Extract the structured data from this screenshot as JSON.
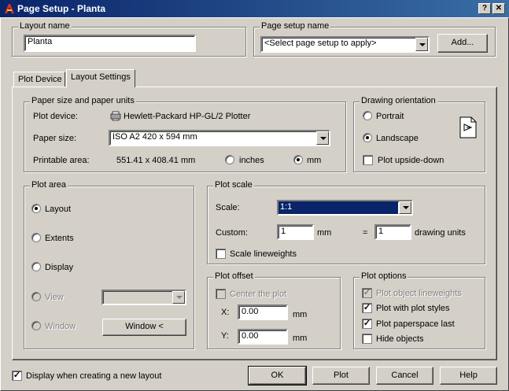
{
  "window": {
    "title": "Page Setup - Planta",
    "help_btn": "?",
    "close_btn": "✕"
  },
  "layout_name": {
    "label": "Layout name",
    "value": "Planta"
  },
  "page_setup_name": {
    "label": "Page setup name",
    "value": "<Select page setup to apply>",
    "add_button": "Add..."
  },
  "tabs": [
    {
      "label": "Plot Device"
    },
    {
      "label": "Layout Settings"
    }
  ],
  "paper": {
    "group_label": "Paper size and paper units",
    "plot_device_label": "Plot device:",
    "plot_device_value": "Hewlett-Packard HP-GL/2 Plotter",
    "paper_size_label": "Paper size:",
    "paper_size_value": "ISO A2 420 x 594 mm",
    "printable_area_label": "Printable area:",
    "printable_area_value": "551.41 x 408.41 mm",
    "inches_label": "inches",
    "mm_label": "mm",
    "selected_unit": "mm"
  },
  "orientation": {
    "group_label": "Drawing orientation",
    "portrait": "Portrait",
    "landscape": "Landscape",
    "upside_down": "Plot upside-down",
    "selected": "landscape",
    "upside_down_checked": false
  },
  "plot_area": {
    "group_label": "Plot area",
    "layout": "Layout",
    "extents": "Extents",
    "display": "Display",
    "view": "View",
    "window": "Window",
    "window_button": "Window <",
    "selected": "layout"
  },
  "plot_scale": {
    "group_label": "Plot scale",
    "scale_label": "Scale:",
    "scale_value": "1:1",
    "custom_label": "Custom:",
    "custom_mm_value": "1",
    "mm_unit": "mm",
    "equals": "=",
    "custom_units_value": "1",
    "drawing_units": "drawing units",
    "scale_lineweights": "Scale lineweights",
    "scale_lineweights_checked": false
  },
  "plot_offset": {
    "group_label": "Plot offset",
    "center": "Center the plot",
    "x_label": "X:",
    "x_value": "0.00",
    "x_unit": "mm",
    "y_label": "Y:",
    "y_value": "0.00",
    "y_unit": "mm"
  },
  "plot_options": {
    "group_label": "Plot options",
    "object_lineweights": "Plot object lineweights",
    "plot_styles": "Plot with plot styles",
    "paperspace_last": "Plot paperspace last",
    "hide_objects": "Hide objects",
    "checkmark": "✓"
  },
  "footer": {
    "display_new_layout": "Display when creating a new layout",
    "display_new_layout_checked": true,
    "ok": "OK",
    "plot": "Plot",
    "cancel": "Cancel",
    "help": "Help"
  },
  "colors": {
    "face": "#d4d0c8",
    "title_start": "#0a246a",
    "title_end": "#3a6ea5",
    "selection": "#0a246a"
  }
}
